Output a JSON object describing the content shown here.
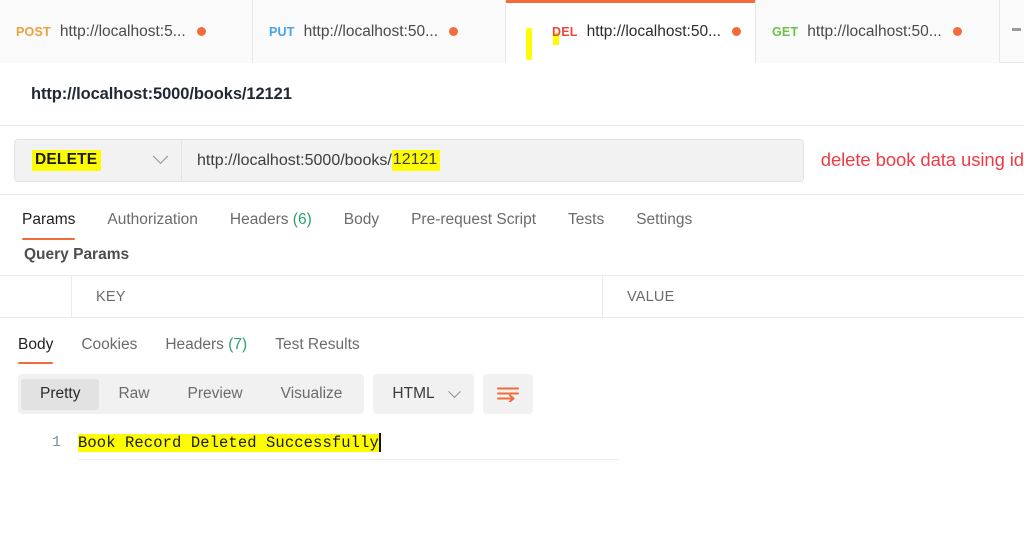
{
  "tabs": [
    {
      "method": "POST",
      "method_class": "m-post",
      "url": "http://localhost:5...",
      "unsaved": "●",
      "active": false
    },
    {
      "method": "PUT",
      "method_class": "m-put",
      "url": "http://localhost:50...",
      "unsaved": "●",
      "active": false
    },
    {
      "method": "DEL",
      "method_class": "m-del",
      "url": "http://localhost:50...",
      "unsaved": "●",
      "active": true
    },
    {
      "method": "GET",
      "method_class": "m-get",
      "url": "http://localhost:50...",
      "unsaved": "●",
      "active": false
    }
  ],
  "request": {
    "title": "http://localhost:5000/books/12121",
    "method": "DELETE",
    "url_prefix": "http://localhost:5000/books/",
    "url_id": "12121",
    "annotation": "delete book data using id",
    "annotation_color": "#ef3b46",
    "highlight_color": "#fdfc00",
    "accent_color": "#f26b3a"
  },
  "request_tabs": [
    {
      "label": "Params",
      "count": "",
      "active": true
    },
    {
      "label": "Authorization",
      "count": "",
      "active": false
    },
    {
      "label": "Headers",
      "count": "(6)",
      "active": false
    },
    {
      "label": "Body",
      "count": "",
      "active": false
    },
    {
      "label": "Pre-request Script",
      "count": "",
      "active": false
    },
    {
      "label": "Tests",
      "count": "",
      "active": false
    },
    {
      "label": "Settings",
      "count": "",
      "active": false
    }
  ],
  "query_params": {
    "section_title": "Query Params",
    "columns": {
      "key": "KEY",
      "value": "VALUE"
    },
    "rows": []
  },
  "response_tabs": [
    {
      "label": "Body",
      "count": "",
      "active": true
    },
    {
      "label": "Cookies",
      "count": "",
      "active": false
    },
    {
      "label": "Headers",
      "count": "(7)",
      "active": false
    },
    {
      "label": "Test Results",
      "count": "",
      "active": false
    }
  ],
  "viewer": {
    "modes": [
      {
        "label": "Pretty",
        "active": true
      },
      {
        "label": "Raw",
        "active": false
      },
      {
        "label": "Preview",
        "active": false
      },
      {
        "label": "Visualize",
        "active": false
      }
    ],
    "format": "HTML",
    "wrap_icon": "wrap-lines-icon"
  },
  "response_body": {
    "line_number": "1",
    "text": "Book Record Deleted Successfully"
  }
}
